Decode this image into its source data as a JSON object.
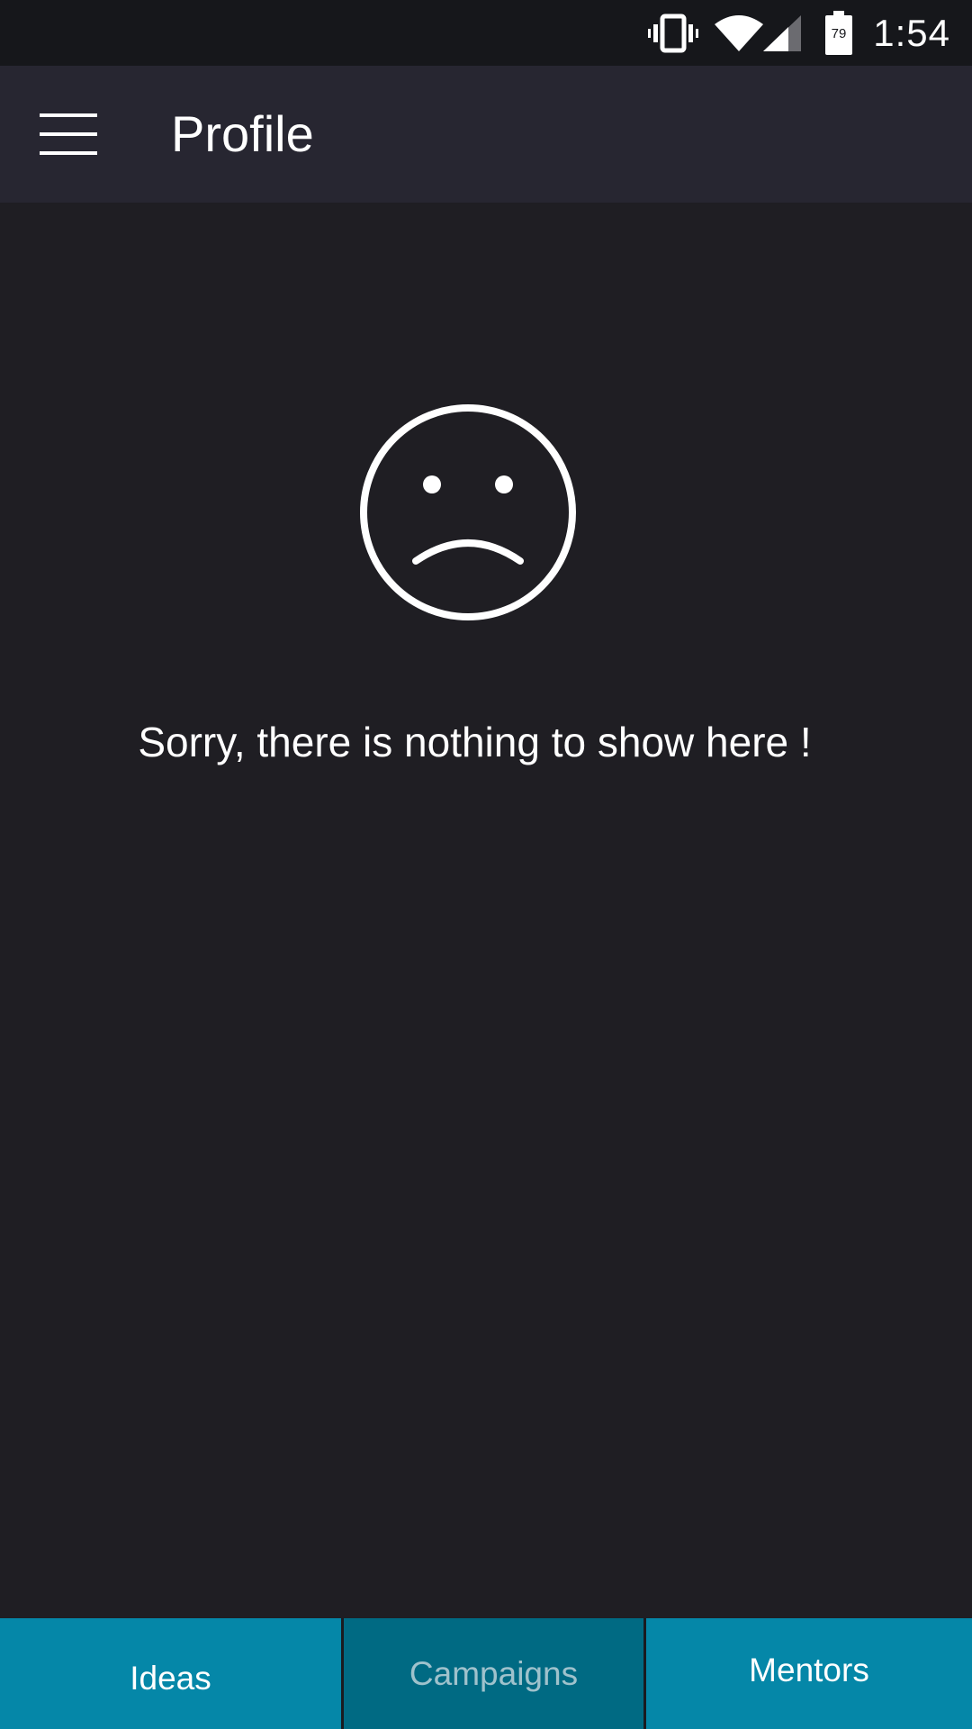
{
  "status_bar": {
    "time": "1:54",
    "battery_level": "79",
    "icons": [
      "vibrate-icon",
      "wifi-icon",
      "cell-signal-icon",
      "battery-icon"
    ]
  },
  "app_bar": {
    "title": "Profile",
    "menu_icon": "hamburger-menu-icon"
  },
  "empty_state": {
    "icon": "sad-face-icon",
    "message": "Sorry, there is nothing to show here !"
  },
  "bottom_nav": {
    "tabs": [
      {
        "label": "Ideas"
      },
      {
        "label": "Campaigns"
      },
      {
        "label": "Mentors"
      }
    ]
  },
  "colors": {
    "background": "#1f1e23",
    "app_bar": "#272631",
    "status_bar": "#16171b",
    "tab_accent": "#0587a8",
    "tab_selected": "#006a83"
  }
}
